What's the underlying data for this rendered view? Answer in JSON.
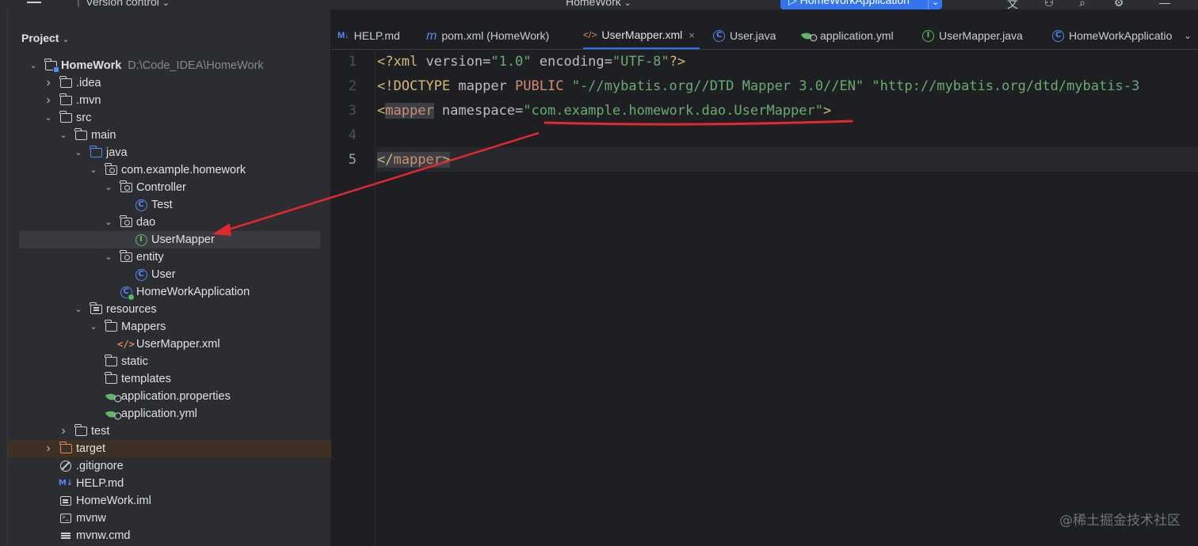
{
  "topbar": {
    "menu_icon": "hamburger-menu-icon",
    "vcs_label": "Version control",
    "project_name": "HomeWork",
    "run_config": "HomeWorkApplication",
    "icons": [
      "translate-icon",
      "add-user-icon",
      "search-icon",
      "settings-icon"
    ]
  },
  "project_panel": {
    "title": "Project",
    "tree": [
      {
        "label": "HomeWork",
        "hint": "D:\\Code_IDEA\\HomeWork",
        "icon": "module-folder-icon",
        "depth": 0,
        "expanded": true,
        "bold": true
      },
      {
        "label": ".idea",
        "icon": "folder-icon",
        "depth": 1,
        "expanded": false
      },
      {
        "label": ".mvn",
        "icon": "folder-icon",
        "depth": 1,
        "expanded": false
      },
      {
        "label": "src",
        "icon": "folder-icon",
        "depth": 1,
        "expanded": true
      },
      {
        "label": "main",
        "icon": "folder-icon",
        "depth": 2,
        "expanded": true
      },
      {
        "label": "java",
        "icon": "source-folder-icon",
        "depth": 3,
        "expanded": true
      },
      {
        "label": "com.example.homework",
        "icon": "package-icon",
        "depth": 4,
        "expanded": true
      },
      {
        "label": "Controller",
        "icon": "package-icon",
        "depth": 5,
        "expanded": true
      },
      {
        "label": "Test",
        "icon": "class-icon",
        "depth": 6
      },
      {
        "label": "dao",
        "icon": "package-icon",
        "depth": 5,
        "expanded": true
      },
      {
        "label": "UserMapper",
        "icon": "interface-icon",
        "depth": 6,
        "selected": true
      },
      {
        "label": "entity",
        "icon": "package-icon",
        "depth": 5,
        "expanded": true
      },
      {
        "label": "User",
        "icon": "class-icon",
        "depth": 6
      },
      {
        "label": "HomeWorkApplication",
        "icon": "spring-app-icon",
        "depth": 5
      },
      {
        "label": "resources",
        "icon": "resources-folder-icon",
        "depth": 3,
        "expanded": true
      },
      {
        "label": "Mappers",
        "icon": "folder-icon",
        "depth": 4,
        "expanded": true
      },
      {
        "label": "UserMapper.xml",
        "icon": "xml-file-icon",
        "depth": 5
      },
      {
        "label": "static",
        "icon": "folder-icon",
        "depth": 4
      },
      {
        "label": "templates",
        "icon": "folder-icon",
        "depth": 4
      },
      {
        "label": "application.properties",
        "icon": "spring-config-icon",
        "depth": 4
      },
      {
        "label": "application.yml",
        "icon": "spring-config-icon",
        "depth": 4
      },
      {
        "label": "test",
        "icon": "folder-icon",
        "depth": 2,
        "expanded": false
      },
      {
        "label": "target",
        "icon": "excluded-folder-icon",
        "depth": 1,
        "expanded": false,
        "excluded": true
      },
      {
        "label": ".gitignore",
        "icon": "ignore-file-icon",
        "depth": 1
      },
      {
        "label": "HELP.md",
        "icon": "markdown-file-icon",
        "depth": 1
      },
      {
        "label": "HomeWork.iml",
        "icon": "iml-file-icon",
        "depth": 1
      },
      {
        "label": "mvnw",
        "icon": "shell-file-icon",
        "depth": 1
      },
      {
        "label": "mvnw.cmd",
        "icon": "text-file-icon",
        "depth": 1
      }
    ]
  },
  "tabs": [
    {
      "label": "HELP.md",
      "icon": "markdown-file-icon",
      "prefix": "M↓"
    },
    {
      "label": "pom.xml (HomeWork)",
      "icon": "maven-icon",
      "prefix": "m"
    },
    {
      "label": "UserMapper.xml",
      "icon": "xml-file-icon",
      "prefix": "</>",
      "active": true,
      "closable": true
    },
    {
      "label": "User.java",
      "icon": "class-icon",
      "prefix": "C"
    },
    {
      "label": "application.yml",
      "icon": "spring-config-icon",
      "prefix": ""
    },
    {
      "label": "UserMapper.java",
      "icon": "interface-icon",
      "prefix": "I"
    },
    {
      "label": "HomeWorkApplicatio",
      "icon": "spring-app-icon",
      "prefix": "C"
    }
  ],
  "editor": {
    "line_numbers": [
      "1",
      "2",
      "3",
      "4",
      "5"
    ],
    "current_line": "5",
    "line1": {
      "open": "<?",
      "name": "xml ",
      "a1": "version",
      "eq1": "=",
      "v1": "\"1.0\"",
      "a2": " encoding",
      "eq2": "=",
      "v2": "\"UTF-8\"",
      "close": "?>"
    },
    "line2": {
      "open": "<!",
      "kw": "DOCTYPE",
      "rest1": " mapper ",
      "pub": "PUBLIC",
      "sp": " ",
      "s1": "\"-//mybatis.org//DTD Mapper 3.0//EN\"",
      "sp2": " ",
      "s2": "\"http://mybatis.org/dtd/mybatis-3"
    },
    "line3": {
      "lt": "<",
      "tag": "mapper",
      "attr": " namespace",
      "eq": "=",
      "q1": "\"",
      "value": "com.example.homework.dao.UserMapper",
      "q2": "\"",
      "gt": ">"
    },
    "line5": {
      "lt": "</",
      "tag": "mapper",
      "gt": ">"
    }
  },
  "colors": {
    "accent": "#3574f0",
    "annotation": "#e0282e",
    "string": "#6aab73",
    "tag": "#d5b778",
    "keyword": "#cf8e6d"
  },
  "watermark": "@稀土掘金技术社区"
}
